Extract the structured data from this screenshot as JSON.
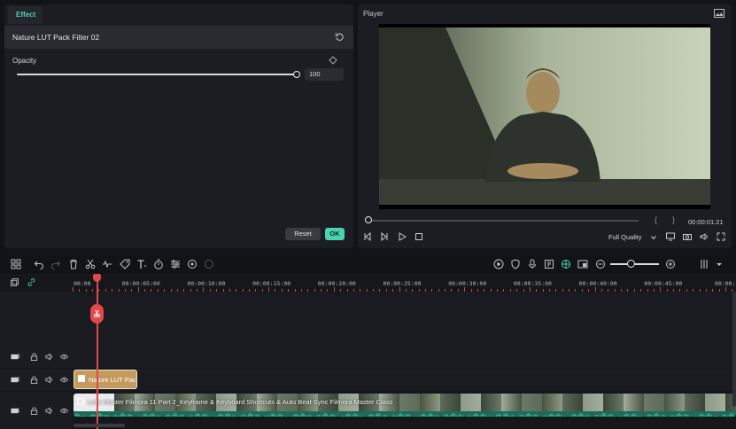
{
  "effect_panel": {
    "tab_label": "Effect",
    "filter_name": "Nature LUT Pack Filter 02",
    "opacity_label": "Opacity",
    "opacity_value": "100",
    "reset_label": "Reset",
    "ok_label": "OK"
  },
  "player": {
    "title": "Player",
    "timecode": "00:00:01:21",
    "mark_in": "{",
    "mark_out": "}",
    "quality": "Full Quality"
  },
  "timeline": {
    "ruler_labels": [
      "00:00",
      "00:00:05:00",
      "00:00:10:00",
      "00:00:15:00",
      "00:00:20:00",
      "00:00:25:00",
      "00:00:30:00",
      "00:00:35:00",
      "00:00:40:00",
      "00:00:45:00",
      "00:00:50"
    ],
    "tracks": [
      {
        "label": "3"
      },
      {
        "label": "2"
      },
      {
        "label": "1"
      }
    ],
    "effect_clip_label": "Nature LUT Pac",
    "video_clip_label": "Let's Master Filmora 11 Part 2_Keyframe & Keyboard Shortcuts & Auto Beat Sync  Filmora Master Class"
  },
  "colors": {
    "accent": "#4ad3ad",
    "playhead": "#e14848",
    "effect_clip": "#c49a5e"
  }
}
